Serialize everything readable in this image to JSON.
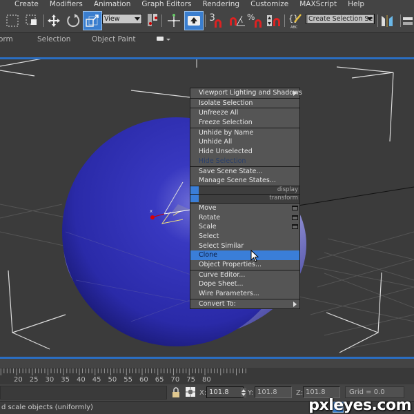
{
  "menubar": {
    "items": [
      "Create",
      "Modifiers",
      "Animation",
      "Graph Editors",
      "Rendering",
      "Customize",
      "MAXScript",
      "Help"
    ]
  },
  "toolbar": {
    "reference_coord_value": "View",
    "named_selection_placeholder": "Create Selection Se",
    "snap_label": "3",
    "percent_label": "%"
  },
  "ribbon": {
    "tabs": [
      "orm",
      "Selection",
      "Object Paint"
    ]
  },
  "context_menu": {
    "sections": [
      [
        {
          "label": "Viewport Lighting and Shadows",
          "submenu": true
        }
      ],
      [
        {
          "label": "Isolate Selection"
        }
      ],
      [
        {
          "label": "Unfreeze All"
        },
        {
          "label": "Freeze Selection"
        }
      ],
      [
        {
          "label": "Unhide by Name"
        },
        {
          "label": "Unhide All"
        },
        {
          "label": "Hide Unselected"
        },
        {
          "label": "Hide Selection",
          "disabled": true
        }
      ],
      [
        {
          "label": "Save Scene State..."
        },
        {
          "label": "Manage Scene States..."
        }
      ]
    ],
    "quad_labels": [
      "display",
      "transform"
    ],
    "transform_sections": [
      [
        {
          "label": "Move",
          "settings": true
        },
        {
          "label": "Rotate",
          "settings": true
        },
        {
          "label": "Scale",
          "settings": true
        },
        {
          "label": "Select"
        },
        {
          "label": "Select Similar"
        },
        {
          "label": "Clone",
          "highlighted": true
        },
        {
          "label": "Object Properties..."
        }
      ],
      [
        {
          "label": "Curve Editor..."
        },
        {
          "label": "Dope Sheet..."
        },
        {
          "label": "Wire Parameters..."
        }
      ],
      [
        {
          "label": "Convert To:",
          "submenu": true
        }
      ]
    ]
  },
  "viewport": {
    "object_color": "#2e2eb4",
    "axis_label": "x"
  },
  "timeline": {
    "labels": [
      "20",
      "25",
      "30",
      "35",
      "40",
      "45",
      "50",
      "55",
      "60",
      "65",
      "70",
      "75",
      "80"
    ]
  },
  "status": {
    "x_label": "X:",
    "y_label": "Y:",
    "z_label": "Z:",
    "x_value": "101.8",
    "y_value": "101.8",
    "z_value": "101.8",
    "grid": "Grid = 0.0",
    "prompt": "d scale objects (uniformly)",
    "watermark": "pxleyes.com"
  },
  "colors": {
    "accent": "#3a7ed8",
    "viewport_border": "#2a6ec2"
  }
}
